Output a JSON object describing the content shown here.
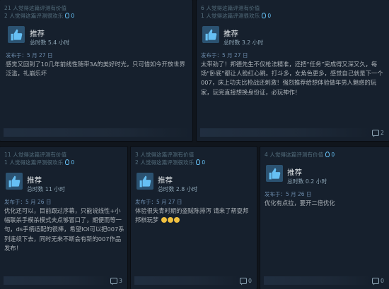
{
  "reviews": [
    {
      "helpful": "21 人觉得这篇评测有价值",
      "funny": "2 人觉得这篇评测很欢乐",
      "awards": "0",
      "verdict": "推荐",
      "hours": "总时数 5.4 小时",
      "posted": "发布于：5 月 27 日",
      "text": "感觉又回到了10几年前线性随带3A的美好时光，只可惜如今开放世界泛滥，礼崩乐坏",
      "comments": ""
    },
    {
      "helpful": "6 人觉得这篇评测有价值",
      "funny": "1 人觉得这篇评测很欢乐",
      "awards": "0",
      "verdict": "推荐",
      "hours": "总时数 3.2 小时",
      "posted": "发布于：5 月 27 日",
      "text": "太带劲了！邦德先生不仅枪法精准，还把“任务”完成得又深又久，每场“卧底”都让人脸红心跳。打斗多，女角色更多，感觉自己就是下一个007，床上功夫比枪战还刺激！强烈推荐给想体验做年男人魅惑的玩家，玩完直接想换身份证，必玩神作！",
      "comments": "2"
    },
    {
      "helpful": "11 人觉得这篇评测有价值",
      "funny": "1 人觉得这篇评测很欢乐",
      "awards": "0",
      "verdict": "推荐",
      "hours": "总时数 11 小时",
      "posted": "发布于：5 月 26 日",
      "text": "优化还可以，目前跟过序幕，只能说线性+小幅联杀手模杀模式夫点够冒口了，期便而等一句，ds手柄适配的很棒，希望IOI可以把007系列连续下去，同时无来不断会有新的007作品发布！",
      "comments": "3"
    },
    {
      "helpful": "3 人觉得这篇评测有价值",
      "funny": "2 人觉得这篇评测很欢乐",
      "awards": "0",
      "verdict": "推荐",
      "hours": "总时数 2.8 小时",
      "posted": "发布于：5 月 27 日",
      "text": "体验很失青时期的盗贼陈排泻 请来了帮耍邦邦棋玩梦",
      "comments": "0"
    },
    {
      "helpful": "4 人觉得这篇评测有价值",
      "funny": "",
      "awards": "0",
      "verdict": "推荐",
      "hours": "总时数 0.2 小时",
      "posted": "发布于：5 月 26 日",
      "text": "优化有点拉，要开二倍优化",
      "comments": "0"
    }
  ]
}
